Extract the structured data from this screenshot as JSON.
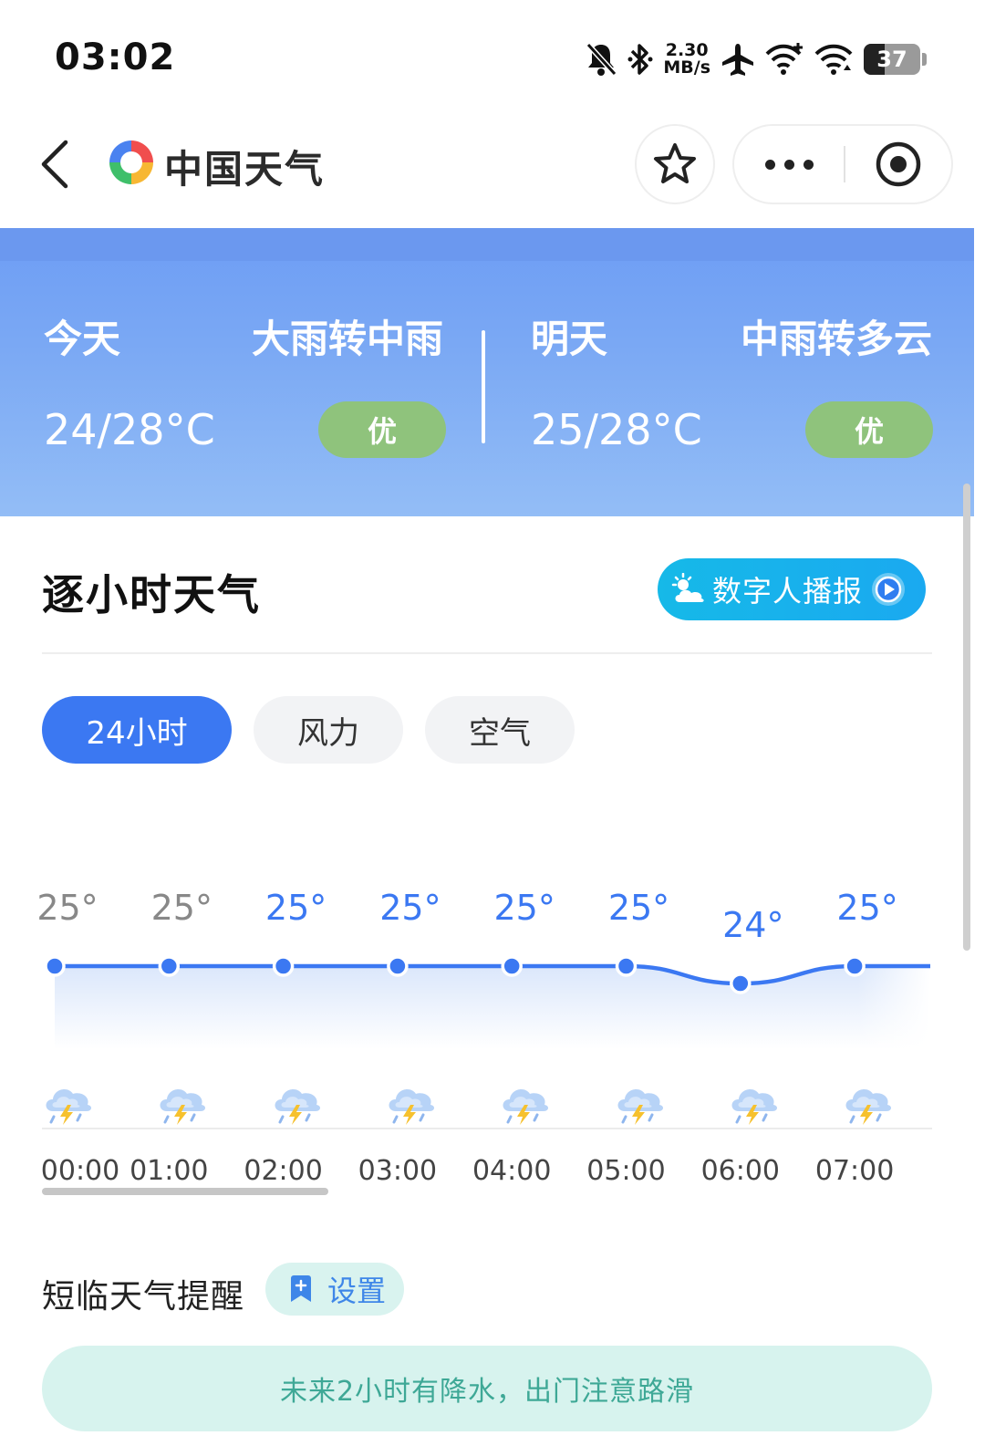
{
  "status_bar": {
    "time": "03:02",
    "net_speed_value": "2.30",
    "net_speed_unit": "MB/s",
    "battery": "37",
    "icons": [
      "bell-off-icon",
      "bluetooth-icon",
      "airplane-icon",
      "wifi-plus-icon",
      "wifi-icon",
      "battery-icon"
    ]
  },
  "nav": {
    "title": "中国天气",
    "icons": [
      "back-icon",
      "logo-icon",
      "star-icon",
      "more-icon",
      "record-icon"
    ]
  },
  "summary": {
    "today": {
      "label": "今天",
      "condition": "大雨转中雨",
      "temp": "24/28°C",
      "aqi": "优"
    },
    "tomorrow": {
      "label": "明天",
      "condition": "中雨转多云",
      "temp": "25/28°C",
      "aqi": "优"
    },
    "colors": {
      "band": "#7aa8f4",
      "aqi": "#8fc37c"
    }
  },
  "hourly": {
    "title": "逐小时天气",
    "broadcast_label": "数字人播报",
    "tabs": [
      {
        "label": "24小时",
        "active": true
      },
      {
        "label": "风力",
        "active": false
      },
      {
        "label": "空气",
        "active": false
      }
    ],
    "hours": [
      {
        "time": "00:00",
        "temp": "25°",
        "value": 25,
        "past": true,
        "icon": "thunder-shower-icon"
      },
      {
        "time": "01:00",
        "temp": "25°",
        "value": 25,
        "past": true,
        "icon": "thunder-shower-icon"
      },
      {
        "time": "02:00",
        "temp": "25°",
        "value": 25,
        "past": false,
        "icon": "thunder-shower-icon"
      },
      {
        "time": "03:00",
        "temp": "25°",
        "value": 25,
        "past": false,
        "icon": "thunder-shower-icon"
      },
      {
        "time": "04:00",
        "temp": "25°",
        "value": 25,
        "past": false,
        "icon": "thunder-shower-icon"
      },
      {
        "time": "05:00",
        "temp": "25°",
        "value": 25,
        "past": false,
        "icon": "thunder-shower-icon"
      },
      {
        "time": "06:00",
        "temp": "24°",
        "value": 24,
        "past": false,
        "icon": "thunder-shower-icon"
      },
      {
        "time": "07:00",
        "temp": "25°",
        "value": 25,
        "past": false,
        "icon": "thunder-shower-icon"
      }
    ],
    "colors": {
      "line": "#3b78f2",
      "current": "#3b78f2",
      "past": "#888888"
    }
  },
  "nowcast": {
    "title": "短临天气提醒",
    "settings_label": "设置",
    "message": "未来2小时有降水，出门注意路滑"
  }
}
